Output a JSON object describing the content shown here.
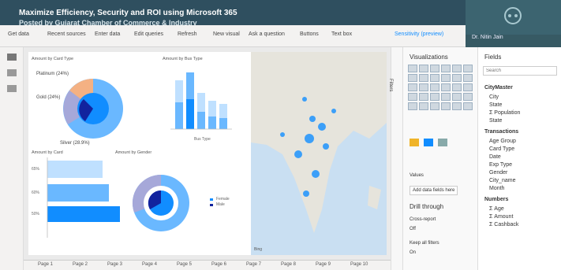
{
  "window": {
    "title": "Maximize Efficiency, Security and ROI using Microsoft 365",
    "subtitle": "Posted by Gujarat Chamber of Commerce & Industry"
  },
  "ribbon": {
    "items": [
      "Get data",
      "Recent sources",
      "Enter data",
      "Edit queries",
      "Refresh",
      "New visual",
      "Ask a question",
      "Buttons",
      "Text box",
      "Sensitivity (preview)"
    ]
  },
  "webcam": {
    "label": "Dr. Nitin Jain"
  },
  "report": {
    "pie1_title": "Amount by Card Type",
    "bar1_title": "Amount by Bus Type",
    "bar2_title": "Amount by Card",
    "donut_title": "Amount by Gender",
    "bar1_legend": "Bus Type",
    "pie1_labels": [
      "Platinum (24%)",
      "Gold (24%)",
      "Silver (28.9%)"
    ],
    "bar2_labels": [
      "65%",
      "60%",
      "50%"
    ],
    "donut_labels": [
      "Female",
      "Male"
    ]
  },
  "map": {
    "attribution": "Bing"
  },
  "tabs": [
    "Page 1",
    "Page 2",
    "Page 3",
    "Page 4",
    "Page 5",
    "Page 6",
    "Page 7",
    "Page 8",
    "Page 9",
    "Page 10"
  ],
  "filters": {
    "label": "Filters"
  },
  "visualizations": {
    "title": "Visualizations",
    "values_label": "Values",
    "add_fields_label": "Add data fields here",
    "drill_label": "Drill through",
    "cross_report_label": "Cross-report",
    "keep_filters_label": "Keep all filters",
    "toggle_off": "Off",
    "toggle_on": "On"
  },
  "fields": {
    "title": "Fields",
    "search_placeholder": "Search",
    "groups": [
      {
        "name": "CityMaster",
        "items": [
          "City",
          "State",
          "Σ Population",
          "State"
        ]
      },
      {
        "name": "Transactions",
        "items": [
          "Age Group",
          "Card Type",
          "Date",
          "Exp Type",
          "Gender",
          "City_name",
          "Month"
        ]
      },
      {
        "name": "Numbers",
        "items": [
          "Σ Age",
          "Σ Amount",
          "Σ Cashback"
        ]
      }
    ]
  },
  "colors": {
    "accent": "#118dff",
    "dark_blue": "#12239e",
    "mid_blue": "#6ab8ff",
    "light_blue": "#bfe0ff",
    "lavender": "#a6a8d9",
    "peach": "#f4b183"
  }
}
